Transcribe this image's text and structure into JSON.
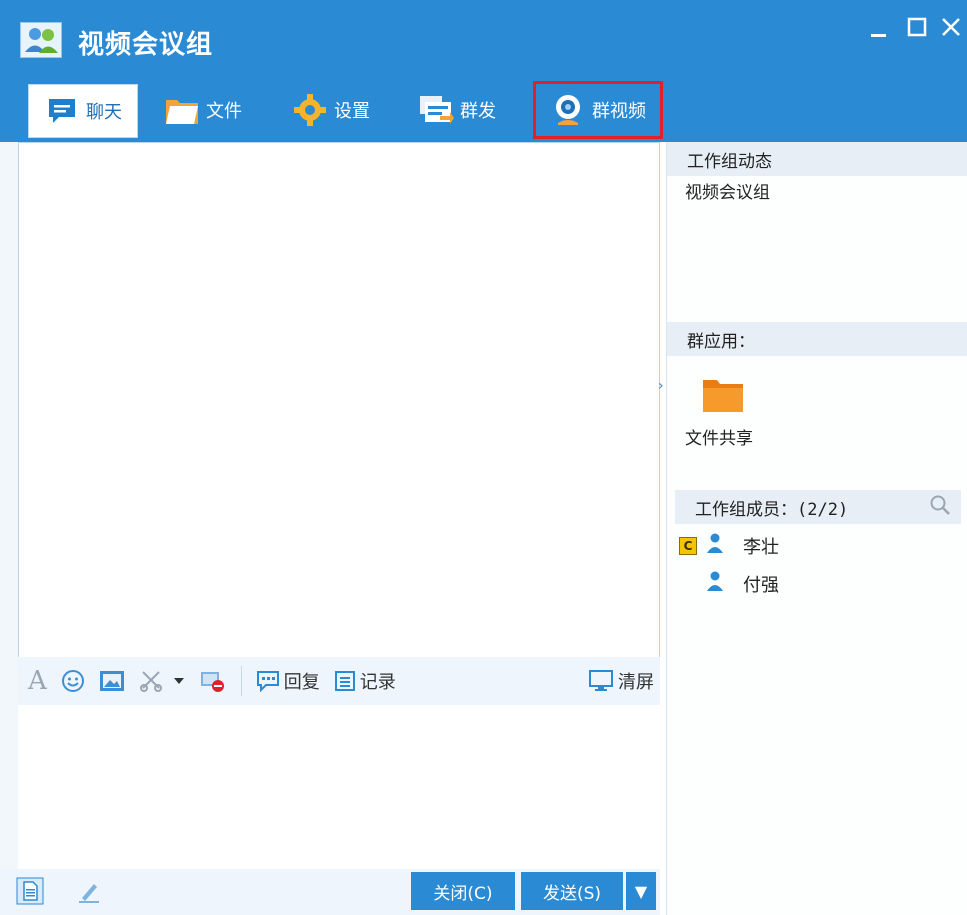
{
  "window": {
    "title": "视频会议组",
    "controls": {
      "minimize": "_",
      "maximize": "□",
      "close": "X"
    }
  },
  "toolbar": {
    "tabs": [
      {
        "label": "聊天",
        "icon": "chat-bubble-icon",
        "active": true
      },
      {
        "label": "文件",
        "icon": "folder-icon",
        "active": false
      },
      {
        "label": "设置",
        "icon": "gear-icon",
        "active": false
      },
      {
        "label": "群发",
        "icon": "broadcast-icon",
        "active": false
      },
      {
        "label": "群视频",
        "icon": "webcam-icon",
        "active": false,
        "highlighted": true
      }
    ]
  },
  "input_toolbar": {
    "font_icon": "A",
    "reply_label": "回复",
    "record_label": "记录",
    "clear_label": "清屏"
  },
  "bottom": {
    "close_label": "关闭(C)",
    "send_label": "发送(S)",
    "send_dropdown": "▼"
  },
  "sidebar": {
    "activity_title": "工作组动态",
    "activity_text": "视频会议组",
    "apps_title": "群应用：",
    "apps": [
      {
        "label": "文件共享",
        "icon": "folder-icon"
      }
    ],
    "members_title": "工作组成员：(2/2)",
    "members": [
      {
        "name": "李壮",
        "badge": "C"
      },
      {
        "name": "付强",
        "badge": ""
      }
    ],
    "expand_arrow": "›"
  },
  "colors": {
    "accent": "#2b8ad4",
    "highlight": "#e0202b",
    "folder": "#f08a1c",
    "section_bg": "#e7eef5"
  }
}
